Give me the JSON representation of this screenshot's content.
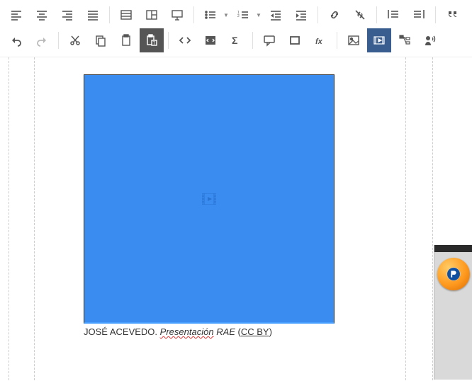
{
  "caption": {
    "author": "JOSÉ ACEVEDO.",
    "title": "Presentación",
    "source": "RAE",
    "license": "CC BY"
  },
  "toolbar": {
    "row1": [
      {
        "name": "align-left-icon"
      },
      {
        "name": "align-center-icon"
      },
      {
        "name": "align-right-icon"
      },
      {
        "name": "align-justify-icon"
      },
      {
        "sep": true
      },
      {
        "name": "insert-table-icon"
      },
      {
        "name": "insert-column-icon"
      },
      {
        "name": "insert-slide-icon"
      },
      {
        "sep": true
      },
      {
        "name": "unordered-list-icon",
        "dd": true
      },
      {
        "name": "ordered-list-icon",
        "dd": true
      },
      {
        "name": "indent-decrease-icon"
      },
      {
        "name": "indent-increase-icon"
      },
      {
        "sep": true
      },
      {
        "name": "link-icon"
      },
      {
        "name": "unlink-icon"
      },
      {
        "sep": true
      },
      {
        "name": "outdent-icon"
      },
      {
        "name": "indent-icon"
      },
      {
        "sep": true
      },
      {
        "name": "blockquote-icon"
      }
    ],
    "row2": [
      {
        "name": "undo-icon"
      },
      {
        "name": "redo-icon"
      },
      {
        "sep": true
      },
      {
        "name": "cut-icon"
      },
      {
        "name": "copy-icon"
      },
      {
        "name": "paste-icon"
      },
      {
        "name": "paste-text-icon",
        "active": true
      },
      {
        "sep": true
      },
      {
        "name": "code-icon"
      },
      {
        "name": "code-block-icon"
      },
      {
        "name": "sigma-icon"
      },
      {
        "sep": true
      },
      {
        "name": "comment-icon"
      },
      {
        "name": "box-icon"
      },
      {
        "name": "fx-icon"
      },
      {
        "sep": true
      },
      {
        "name": "image-icon"
      },
      {
        "name": "video-icon",
        "activeblue": true
      },
      {
        "name": "tree-icon"
      },
      {
        "name": "speaker-icon"
      }
    ]
  }
}
